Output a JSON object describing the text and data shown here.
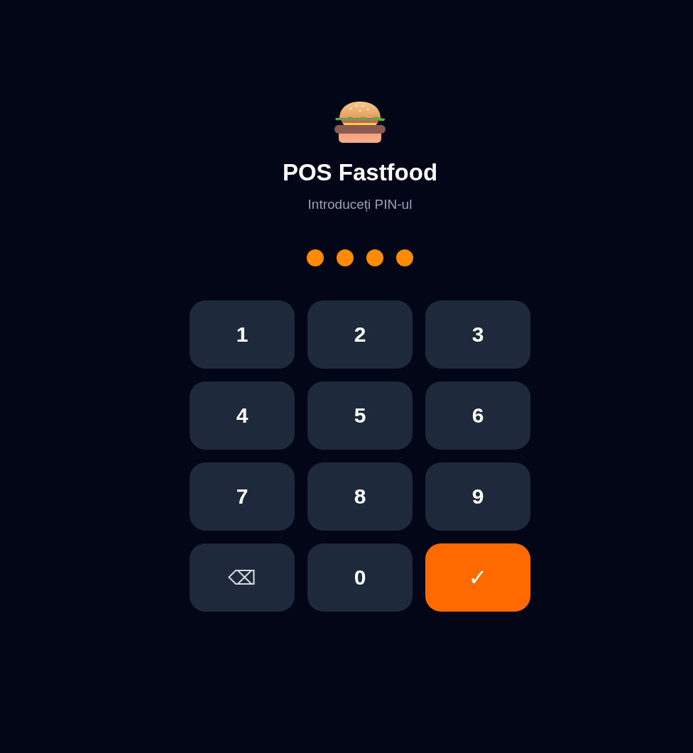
{
  "app": {
    "title": "POS Fastfood",
    "subtitle": "Introduceți PIN-ul"
  },
  "pin_dots": [
    {
      "filled": true
    },
    {
      "filled": true
    },
    {
      "filled": true
    },
    {
      "filled": true
    }
  ],
  "keypad": [
    {
      "label": "1",
      "kind": "digit"
    },
    {
      "label": "2",
      "kind": "digit"
    },
    {
      "label": "3",
      "kind": "digit"
    },
    {
      "label": "4",
      "kind": "digit"
    },
    {
      "label": "5",
      "kind": "digit"
    },
    {
      "label": "6",
      "kind": "digit"
    },
    {
      "label": "7",
      "kind": "digit"
    },
    {
      "label": "8",
      "kind": "digit"
    },
    {
      "label": "9",
      "kind": "digit"
    },
    {
      "label": "⌫",
      "kind": "backspace"
    },
    {
      "label": "0",
      "kind": "digit"
    },
    {
      "label": "✓",
      "kind": "confirm"
    }
  ]
}
